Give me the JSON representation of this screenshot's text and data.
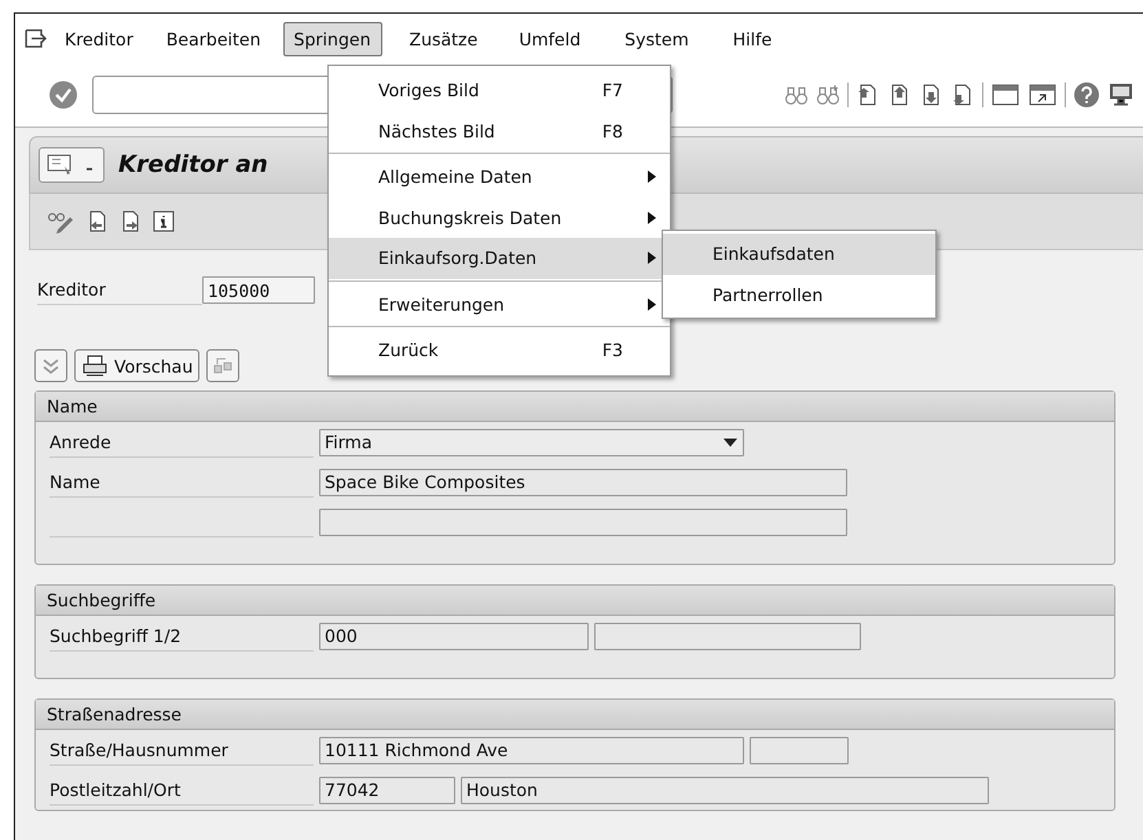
{
  "menubar": [
    {
      "label": "Kreditor",
      "selected": false
    },
    {
      "label": "Bearbeiten",
      "selected": false
    },
    {
      "label": "Springen",
      "selected": true
    },
    {
      "label": "Zusätze",
      "selected": false
    },
    {
      "label": "Umfeld",
      "selected": false
    },
    {
      "label": "System",
      "selected": false
    },
    {
      "label": "Hilfe",
      "selected": false
    }
  ],
  "title": "Kreditor an",
  "header_field": {
    "label": "Kreditor",
    "value": "105000"
  },
  "buttons": [
    "Vorschau"
  ],
  "groups": [
    {
      "title": "Name",
      "rows": [
        {
          "label": "Anrede",
          "fields": [
            {
              "kind": "dropdown",
              "value": "Firma"
            }
          ]
        },
        {
          "label": "Name",
          "fields": [
            {
              "kind": "text",
              "value": "Space Bike Composites"
            }
          ]
        },
        {
          "fields": [
            {
              "kind": "text"
            }
          ]
        }
      ]
    },
    {
      "title": "Suchbegriffe",
      "rows": [
        {
          "label": "Suchbegriff 1/2",
          "fields": [
            {
              "kind": "text",
              "value": "000"
            },
            {
              "kind": "text"
            }
          ]
        }
      ]
    },
    {
      "title": "Straßenadresse",
      "rows": [
        {
          "label": "Straße/Hausnummer",
          "fields": [
            {
              "kind": "text",
              "value": "10111 Richmond Ave"
            },
            {
              "kind": "text"
            }
          ]
        },
        {
          "label": "Postleitzahl/Ort",
          "fields": [
            {
              "kind": "text",
              "value": "77042"
            },
            {
              "kind": "text",
              "value": "Houston"
            }
          ]
        }
      ]
    }
  ],
  "menu": {
    "items": [
      {
        "kind": "item",
        "label": "Voriges Bild",
        "shortcut": "F7",
        "selected": false
      },
      {
        "kind": "item",
        "label": "Nächstes Bild",
        "shortcut": "F8",
        "selected": false
      },
      {
        "kind": "separator"
      },
      {
        "kind": "submenu",
        "label": "Allgemeine Daten",
        "selected": false
      },
      {
        "kind": "submenu",
        "label": "Buchungskreis Daten",
        "selected": false
      },
      {
        "kind": "submenu",
        "label": "Einkaufsorg.Daten",
        "selected": true
      },
      {
        "kind": "separator"
      },
      {
        "kind": "submenu",
        "label": "Erweiterungen",
        "selected": false
      },
      {
        "kind": "separator"
      },
      {
        "kind": "item",
        "label": "Zurück",
        "shortcut": "F3",
        "selected": false
      }
    ],
    "submenu": [
      {
        "label": "Einkaufsdaten",
        "selected": true
      },
      {
        "label": "Partnerrollen",
        "selected": false
      }
    ]
  }
}
